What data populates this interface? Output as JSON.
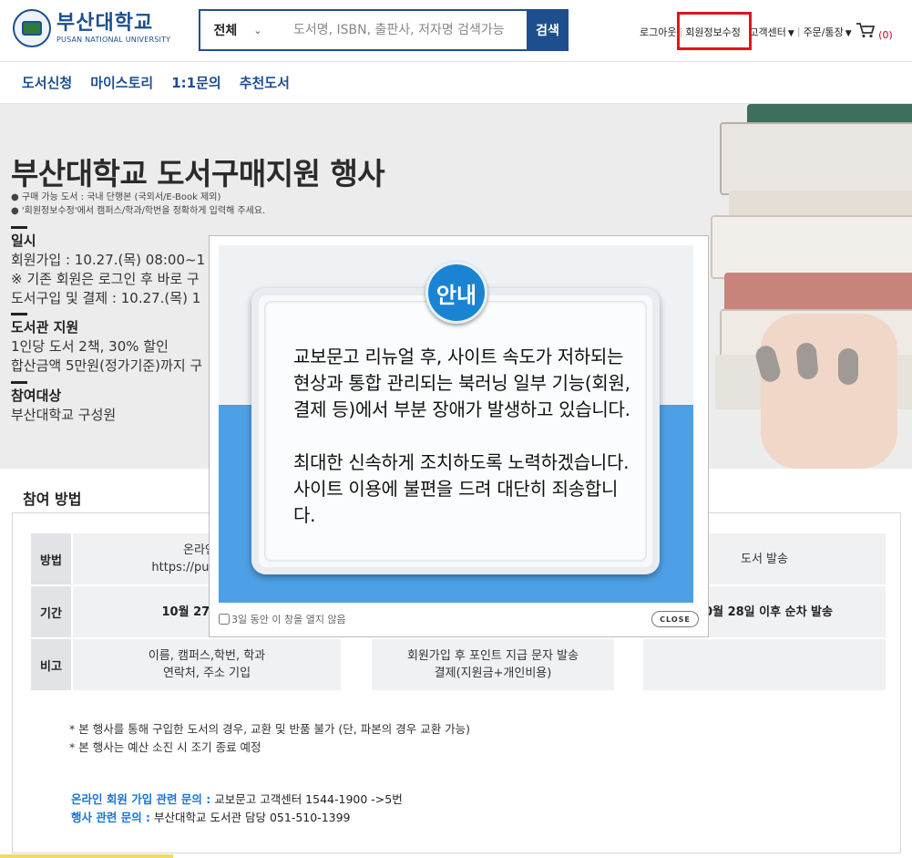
{
  "header": {
    "logo_kor": "부산대학교",
    "logo_eng": "PUSAN NATIONAL UNIVERSITY",
    "search_category": "전체",
    "search_placeholder": "도서명, ISBN, 출판사, 저자명 검색가능",
    "search_button": "검색",
    "util": {
      "logout": "로그아웃",
      "member_edit": "회원정보수정",
      "customer_center": "고객센터",
      "orders": "주문/통장",
      "cart_count": "(0)"
    }
  },
  "nav": {
    "items": [
      {
        "label": "도서신청"
      },
      {
        "label": "마이스토리"
      },
      {
        "label": "1:1문의"
      },
      {
        "label": "추천도서"
      }
    ]
  },
  "hero": {
    "title": "부산대학교 도서구매지원 행사",
    "notes": [
      "● 구매 가능 도서 : 국내 단행본 (국외서/E-Book 제외)",
      "● '회원정보수정'에서 캠퍼스/학과/학번을 정확하게 입력해 주세요."
    ],
    "sections": [
      {
        "heading": "일시",
        "lines": [
          "회원가입 : 10.27.(목) 08:00~1",
          "※ 기존 회원은 로그인 후 바로 구",
          "도서구입 및 결제 : 10.27.(목) 1"
        ]
      },
      {
        "heading": "도서관 지원",
        "lines": [
          "1인당 도서 2책, 30% 할인",
          "합산금액 5만원(정가기준)까지 구"
        ]
      },
      {
        "heading": "참여대상",
        "lines": [
          "부산대학교 구성원"
        ]
      }
    ]
  },
  "participation": {
    "title": "참여 방법",
    "rows": [
      {
        "label": "방법",
        "cells": [
          [
            "온라인 회",
            "https://pusan.kyob"
          ],
          [],
          [
            "도서 발송"
          ]
        ]
      },
      {
        "label": "기간",
        "cells": [
          [
            "10월 27일(목) ("
          ],
          [],
          [
            "10월 28일 이후 순차 발송"
          ]
        ]
      },
      {
        "label": "비고",
        "cells": [
          [
            "이름, 캠퍼스,학번, 학과",
            "연락처, 주소 기입"
          ],
          [
            "회원가입 후 포인트 지급 문자 발송",
            "결제(지원금+개인비용)"
          ],
          []
        ]
      }
    ],
    "notes": [
      "* 본 행사를 통해 구입한 도서의 경우, 교환 및 반품 불가 (단, 파본의 경우 교환 가능)",
      "* 본 행사는 예산 소진 시 조기 종료 예정"
    ],
    "contacts": [
      {
        "key": "온라인 회원 가입 관련 문의 :",
        "value": " 교보문고 고객센터 1544-1900 ->5번"
      },
      {
        "key": "행사 관련 문의 :",
        "value": " 부산대학교 도서관 담당 051-510-1399"
      }
    ]
  },
  "modal": {
    "badge": "안내",
    "paragraphs": [
      "교보문고 리뉴얼 후, 사이트 속도가 저하되는 현상과 통합 관리되는 북러닝 일부 기능(회원, 결제 등)에서 부분 장애가 발생하고 있습니다.",
      "최대한 신속하게 조치하도록 노력하겠습니다. 사이트 이용에 불편을 드려 대단히 죄송합니다."
    ],
    "dont_show": "3일 동안 이 창을 열지 않음",
    "close": "CLOSE"
  },
  "colors": {
    "brand": "#1d4f8f",
    "highlight_box": "#e0141e",
    "modal_blue": "#4ea0e6",
    "contact_key": "#1a73d8"
  }
}
